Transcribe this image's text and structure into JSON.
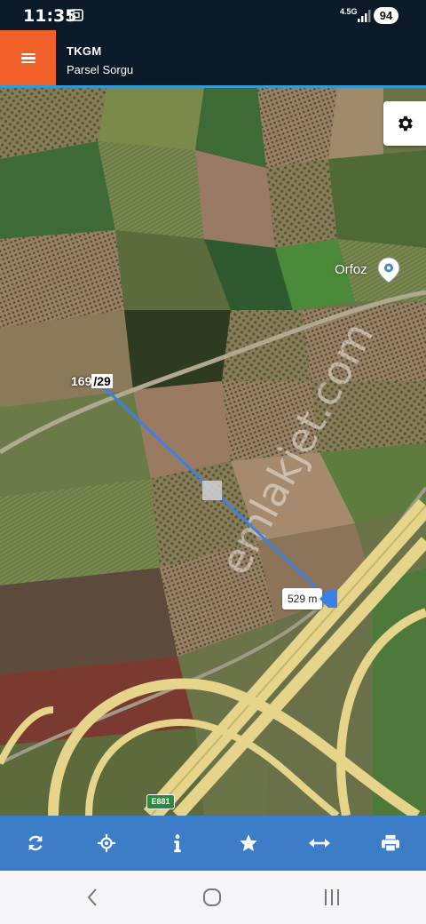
{
  "status_bar": {
    "time": "11:35",
    "network": "4.5G",
    "battery": "94"
  },
  "app_bar": {
    "title": "TKGM",
    "subtitle": "Parsel Sorgu",
    "menu_icon": "hamburger-menu-icon",
    "accent_color": "#f2602a"
  },
  "map": {
    "settings_icon": "gear-icon",
    "parcel_label_prefix": "169",
    "parcel_label_suffix": "/29",
    "place_label": "Orfoz",
    "measure_distance": "529 m",
    "road_shield": "E881",
    "watermark": "emlakjet.com",
    "measure_line_color": "#3a80e8"
  },
  "toolbar": {
    "color": "#3b7ec7",
    "buttons": [
      {
        "icon": "refresh-icon"
      },
      {
        "icon": "locate-icon"
      },
      {
        "icon": "info-icon"
      },
      {
        "icon": "star-icon"
      },
      {
        "icon": "measure-icon"
      },
      {
        "icon": "print-icon"
      }
    ]
  },
  "nav_bar": {
    "buttons": [
      "back-icon",
      "home-icon",
      "recents-icon"
    ]
  }
}
